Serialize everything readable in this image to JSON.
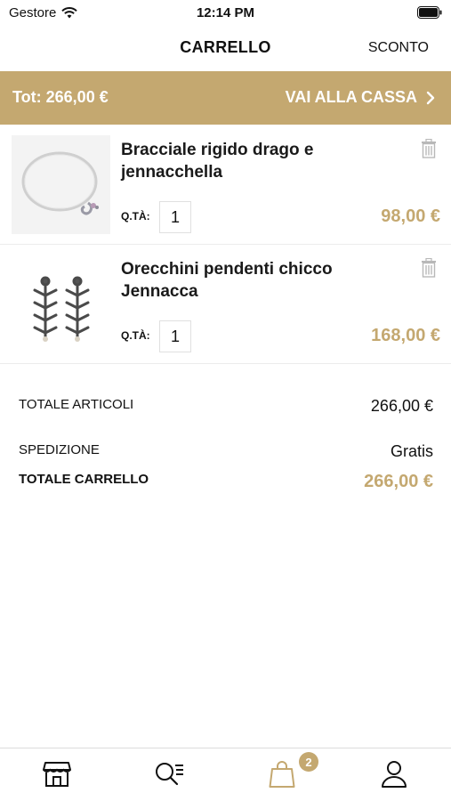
{
  "status_bar": {
    "carrier": "Gestore",
    "time": "12:14 PM"
  },
  "header": {
    "title": "CARRELLO",
    "discount_label": "SCONTO"
  },
  "checkout": {
    "total_label": "Tot: 266,00 €",
    "button_label": "VAI ALLA CASSA"
  },
  "cart": {
    "items": [
      {
        "name": "Bracciale rigido drago e jennacchella",
        "qty_label": "Q.TÀ:",
        "quantity": "1",
        "price": "98,00 €",
        "image": "bracelet-image"
      },
      {
        "name": "Orecchini pendenti chicco Jennacca",
        "qty_label": "Q.TÀ:",
        "quantity": "1",
        "price": "168,00 €",
        "image": "earrings-image"
      }
    ]
  },
  "summary": {
    "articles_label": "TOTALE ARTICOLI",
    "articles_value": "266,00 €",
    "shipping_label": "SPEDIZIONE",
    "shipping_value": "Gratis",
    "total_label": "TOTALE CARRELLO",
    "total_value": "266,00 €"
  },
  "tab_bar": {
    "tabs": [
      {
        "icon": "store-icon"
      },
      {
        "icon": "search-list-icon"
      },
      {
        "icon": "shopping-bag-icon",
        "badge": "2",
        "active": true
      },
      {
        "icon": "user-icon"
      }
    ]
  },
  "colors": {
    "accent": "#c4a870",
    "text": "#111111"
  }
}
